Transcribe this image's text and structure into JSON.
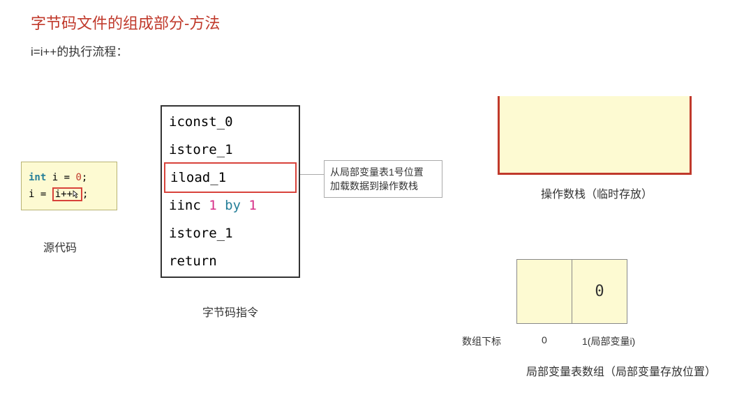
{
  "title": "字节码文件的组成部分-方法",
  "subtitle": "i=i++的执行流程：",
  "source": {
    "line1_kw": "int",
    "line1_rest": " i = ",
    "line1_val": "0",
    "line1_end": ";",
    "line2_pre": "i = ",
    "line2_expr": "i++",
    "line2_end": ";",
    "label": "源代码"
  },
  "bytecode": {
    "lines": {
      "l0": "iconst_0",
      "l1": "istore_1",
      "l2": "iload_1",
      "l3_pre": "iinc ",
      "l3_arg1": "1",
      "l3_mid": " by ",
      "l3_arg2": "1",
      "l4": "istore_1",
      "l5": "return"
    },
    "label": "字节码指令"
  },
  "callout": {
    "line1": "从局部变量表1号位置",
    "line2": "加载数据到操作数栈"
  },
  "stack": {
    "label": "操作数栈（临时存放）"
  },
  "lvt": {
    "cell0": "",
    "cell1": "0",
    "index_label": "数组下标",
    "idx0": "0",
    "idx1": "1(局部变量i)",
    "caption": "局部变量表数组（局部变量存放位置）"
  }
}
